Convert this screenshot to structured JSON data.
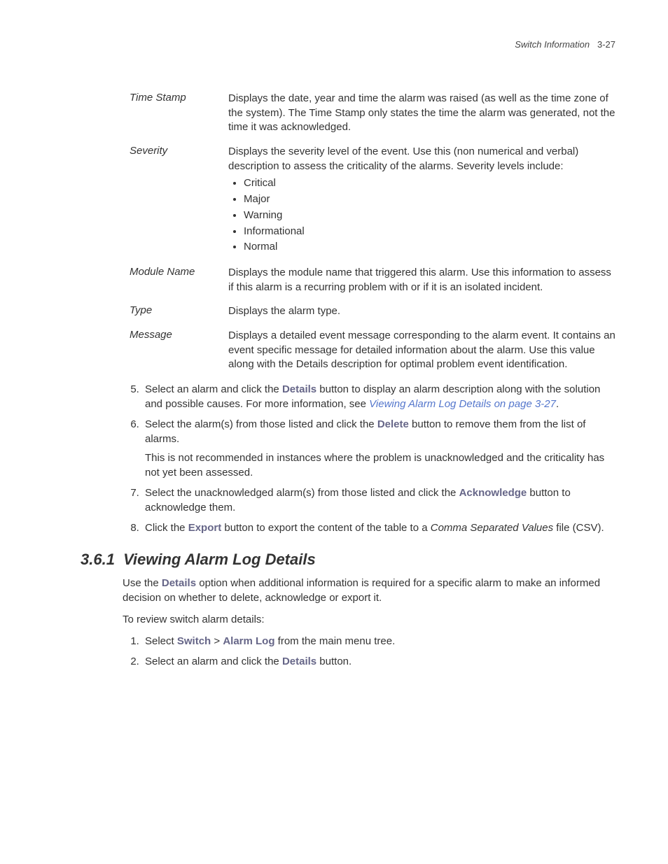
{
  "header": {
    "title": "Switch Information",
    "page": "3-27"
  },
  "definitions": [
    {
      "term": "Time Stamp",
      "desc": "Displays the date, year and time the alarm was raised (as well as the time zone of the system). The Time Stamp only states the time the alarm was generated, not the time it was acknowledged."
    },
    {
      "term": "Severity",
      "desc": "Displays the severity level of the event. Use this (non numerical and verbal) description to assess the criticality of the alarms. Severity levels include:",
      "items": [
        "Critical",
        "Major",
        "Warning",
        "Informational",
        "Normal"
      ]
    },
    {
      "term": "Module Name",
      "desc": "Displays the module name that triggered this alarm. Use this information to assess if this alarm is a recurring problem with or if it is an isolated incident."
    },
    {
      "term": "Type",
      "desc": "Displays the alarm type."
    },
    {
      "term": "Message",
      "desc": "Displays a detailed event message corresponding to the alarm event. It contains an event specific message for detailed information about the alarm. Use this value along with the Details description for optimal problem event identification."
    }
  ],
  "steps_a": {
    "start": 5,
    "items": [
      {
        "pre": "Select an alarm and click the ",
        "bold": "Details",
        "post": " button to display an alarm description along with the solution and possible causes. For more information, see ",
        "link": "Viewing Alarm Log Details on page 3-27",
        "after_link": "."
      },
      {
        "pre": "Select the alarm(s) from those listed and click the ",
        "bold": "Delete",
        "post": " button to remove them from the list of alarms.",
        "para": "This is not recommended in instances where the problem is unacknowledged and the criticality has not yet been assessed."
      },
      {
        "pre": "Select the unacknowledged alarm(s) from those listed and click the ",
        "bold": "Acknowledge",
        "post": " button to acknowledge them."
      },
      {
        "pre": "Click the ",
        "bold": "Export",
        "post": " button to export the content of the table to a ",
        "italic": "Comma Separated Values",
        "after_italic": " file (CSV)."
      }
    ]
  },
  "section": {
    "number": "3.6.1",
    "title": "Viewing Alarm Log Details",
    "intro_pre": "Use the ",
    "intro_bold": "Details",
    "intro_post": " option when additional information is required for a specific alarm to make an informed decision on whether to delete, acknowledge or export it.",
    "sub": "To review switch alarm details:"
  },
  "steps_b": {
    "start": 1,
    "items": [
      {
        "pre": "Select ",
        "bold1": "Switch",
        "mid": " > ",
        "bold2": "Alarm Log",
        "post": " from the main menu tree."
      },
      {
        "pre": "Select an alarm and click the ",
        "bold1": "Details",
        "post": " button."
      }
    ]
  }
}
